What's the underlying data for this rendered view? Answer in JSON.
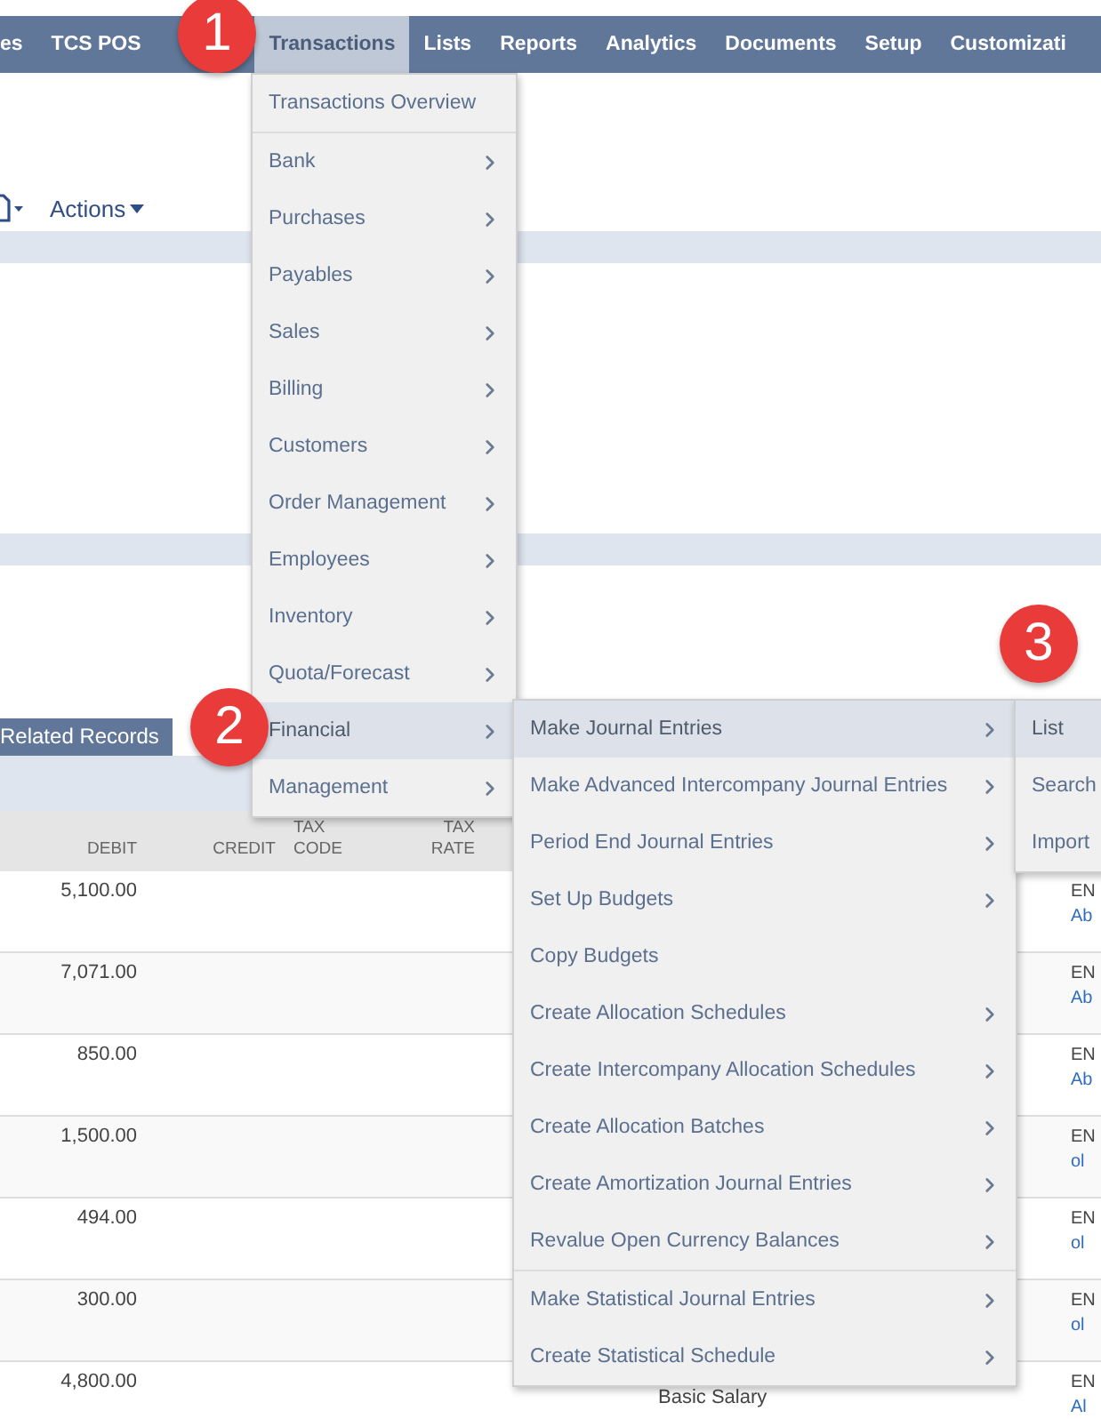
{
  "nav": {
    "items": [
      {
        "label": "es",
        "selected": false
      },
      {
        "label": "TCS POS",
        "selected": false
      },
      {
        "label": "Transactions",
        "selected": true
      },
      {
        "label": "Lists",
        "selected": false
      },
      {
        "label": "Reports",
        "selected": false
      },
      {
        "label": "Analytics",
        "selected": false
      },
      {
        "label": "Documents",
        "selected": false
      },
      {
        "label": "Setup",
        "selected": false
      },
      {
        "label": "Customizati",
        "selected": false
      }
    ]
  },
  "toolbar": {
    "actions_label": "Actions"
  },
  "related_bar": {
    "button": "Related Records"
  },
  "table": {
    "columns": [
      "DEBIT",
      "CREDIT",
      "TAX CODE",
      "TAX RATE"
    ],
    "rows": [
      {
        "debit": "5,100.00",
        "right": [
          "EN",
          "Ab"
        ]
      },
      {
        "debit": "7,071.00",
        "right": [
          "EN",
          "Ab"
        ]
      },
      {
        "debit": "850.00",
        "right": [
          "EN",
          "Ab"
        ]
      },
      {
        "debit": "1,500.00",
        "right": [
          "EN",
          "ol"
        ]
      },
      {
        "debit": "494.00",
        "right": [
          "EN",
          "ol"
        ]
      },
      {
        "debit": "300.00",
        "right": [
          "EN",
          "ol"
        ]
      },
      {
        "debit": "4,800.00",
        "memo": "Basic Salary",
        "right": [
          "EN",
          "Al"
        ]
      }
    ]
  },
  "menus": [
    {
      "sections": [
        [
          {
            "label": "Transactions Overview",
            "selected": false,
            "submenu": false
          }
        ],
        [
          {
            "label": "Bank",
            "selected": false,
            "submenu": true
          },
          {
            "label": "Purchases",
            "selected": false,
            "submenu": true
          },
          {
            "label": "Payables",
            "selected": false,
            "submenu": true
          },
          {
            "label": "Sales",
            "selected": false,
            "submenu": true
          },
          {
            "label": "Billing",
            "selected": false,
            "submenu": true
          },
          {
            "label": "Customers",
            "selected": false,
            "submenu": true
          },
          {
            "label": "Order Management",
            "selected": false,
            "submenu": true
          },
          {
            "label": "Employees",
            "selected": false,
            "submenu": true
          },
          {
            "label": "Inventory",
            "selected": false,
            "submenu": true
          },
          {
            "label": "Quota/Forecast",
            "selected": false,
            "submenu": true
          },
          {
            "label": "Financial",
            "selected": true,
            "submenu": true
          },
          {
            "label": "Management",
            "selected": false,
            "submenu": true
          }
        ]
      ]
    },
    {
      "sections": [
        [
          {
            "label": "Make Journal Entries",
            "selected": true,
            "submenu": true
          },
          {
            "label": "Make Advanced Intercompany Journal Entries",
            "selected": false,
            "submenu": true
          },
          {
            "label": "Period End Journal Entries",
            "selected": false,
            "submenu": true
          },
          {
            "label": "Set Up Budgets",
            "selected": false,
            "submenu": true
          },
          {
            "label": "Copy Budgets",
            "selected": false,
            "submenu": false
          },
          {
            "label": "Create Allocation Schedules",
            "selected": false,
            "submenu": true
          },
          {
            "label": "Create Intercompany Allocation Schedules",
            "selected": false,
            "submenu": true
          },
          {
            "label": "Create Allocation Batches",
            "selected": false,
            "submenu": true
          },
          {
            "label": "Create Amortization Journal Entries",
            "selected": false,
            "submenu": true
          },
          {
            "label": "Revalue Open Currency Balances",
            "selected": false,
            "submenu": true
          }
        ],
        [
          {
            "label": "Make Statistical Journal Entries",
            "selected": false,
            "submenu": true
          },
          {
            "label": "Create Statistical Schedule",
            "selected": false,
            "submenu": true
          }
        ]
      ]
    },
    {
      "sections": [
        [
          {
            "label": "List",
            "selected": true,
            "submenu": false
          },
          {
            "label": "Search",
            "selected": false,
            "submenu": false
          },
          {
            "label": "Import",
            "selected": false,
            "submenu": false
          }
        ]
      ]
    }
  ],
  "badges": [
    "1",
    "2",
    "3"
  ]
}
